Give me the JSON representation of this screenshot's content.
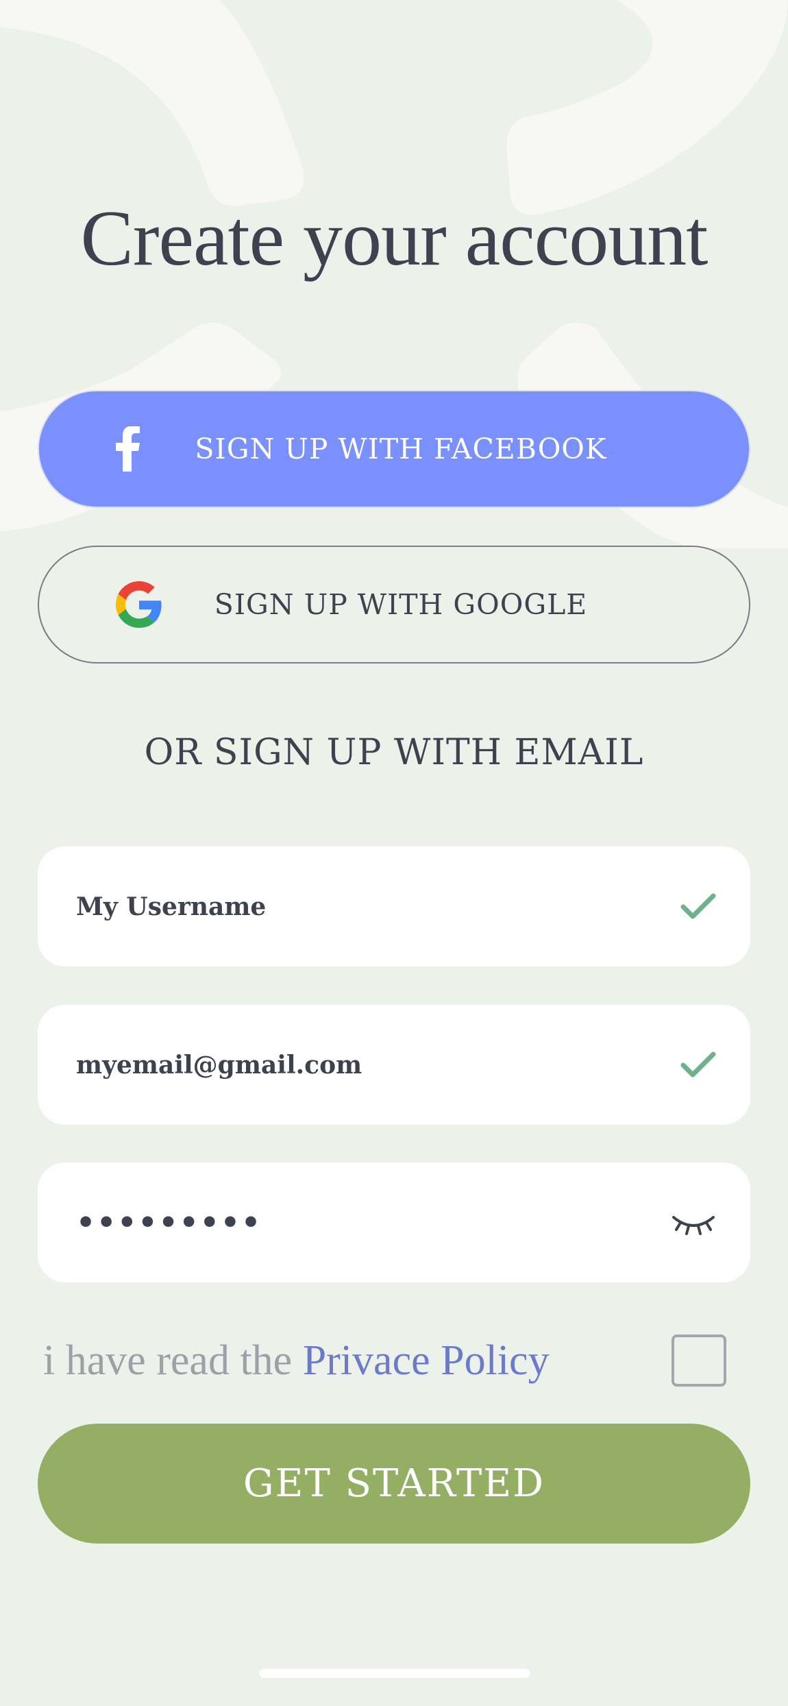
{
  "title": "Create your account",
  "buttons": {
    "facebook": {
      "label": "SIGN UP WITH FACEBOOK",
      "icon": "facebook-icon"
    },
    "google": {
      "label": "SIGN UP WITH GOOGLE",
      "icon": "google-icon"
    }
  },
  "divider_text": "OR SIGN UP WITH EMAIL",
  "fields": {
    "username": {
      "value": "My Username",
      "status_icon": "check-icon"
    },
    "email": {
      "value": "myemail@gmail.com",
      "status_icon": "check-icon"
    },
    "password": {
      "value": "•••••••••",
      "toggle_icon": "eye-closed-icon"
    }
  },
  "policy": {
    "prefix": "i have read the ",
    "link": "Privace Policy",
    "checked": false
  },
  "cta": {
    "label": "GET STARTED"
  },
  "colors": {
    "background": "#ECF1E9",
    "facebook": "#7A90FC",
    "cta": "#94AE64",
    "check": "#6DB28C",
    "text": "#3E414E",
    "link": "#6C7ACC"
  }
}
